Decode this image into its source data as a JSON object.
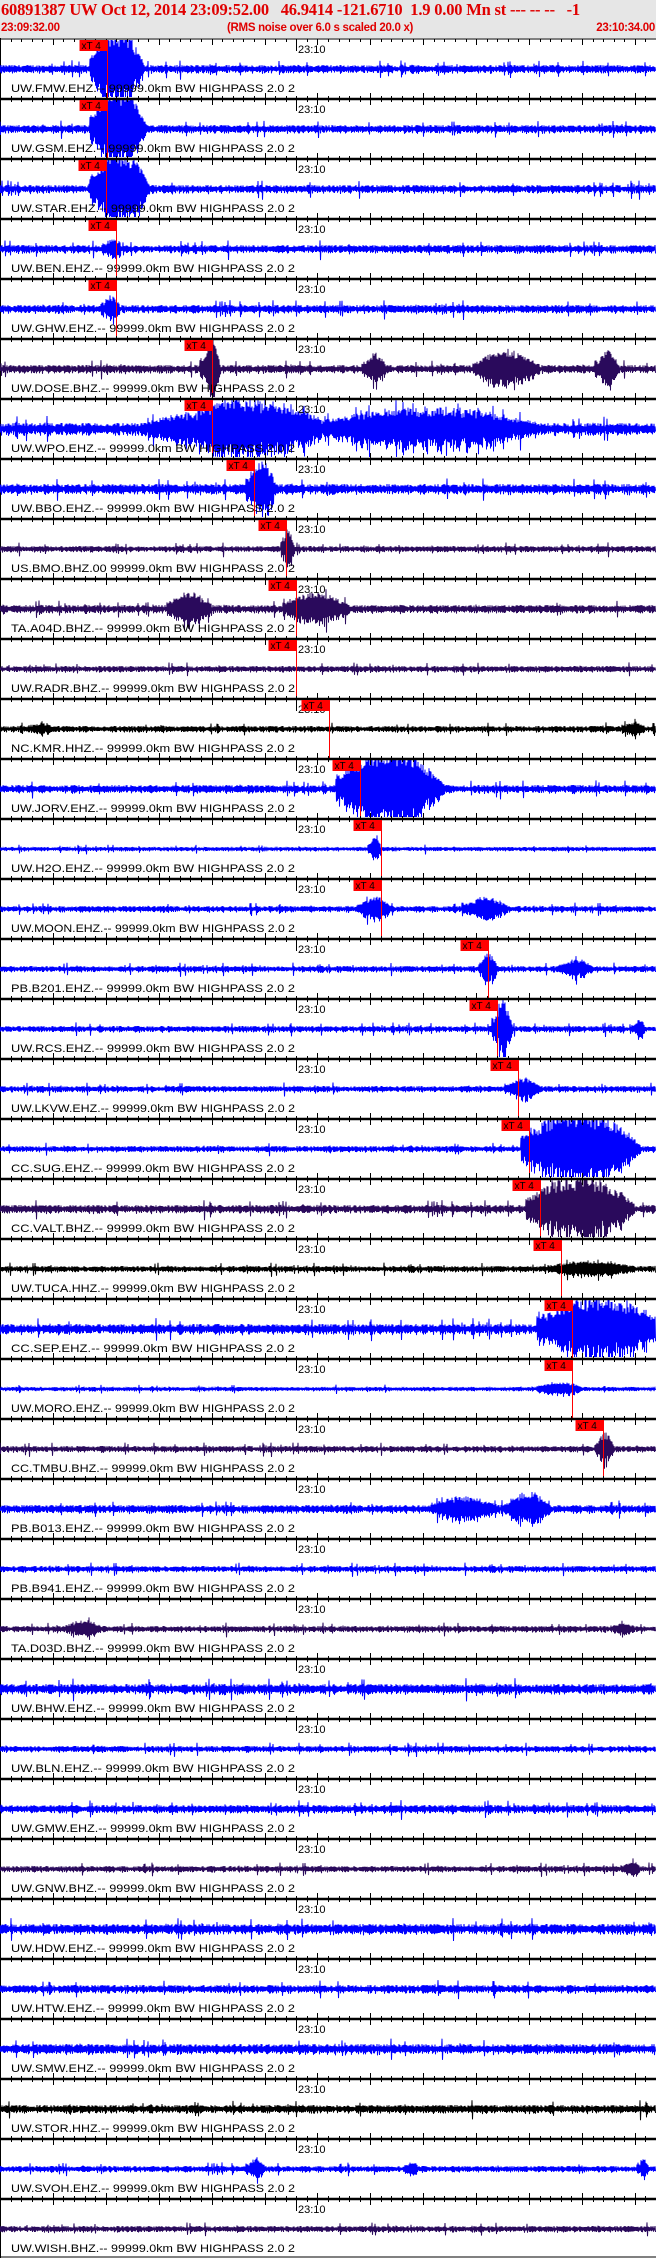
{
  "header": {
    "title": "60891387 UW Oct 12, 2014 23:09:52.00   46.9414 -121.6710  1.9 0.00 Mn st --- -- --   -1",
    "start_time": "23:09:32.00",
    "rms_note": "(RMS noise over 6.0 s scaled 20.0 x)",
    "end_time": "23:10:34.00"
  },
  "time_axis": {
    "span_seconds": 62,
    "minute_label": "23:10",
    "minute_offset_seconds": 28
  },
  "pick_label": "xT 4",
  "colors": {
    "EHZ": "#0000ff",
    "BHZ": "#2a0a5c",
    "HHZ": "#000000",
    "pick": "#ff0000",
    "header_bg": "#e6e6e6",
    "header_text": "#e00000"
  },
  "panels": [
    {
      "label": "UW.FMW.EHZ.-- 99999.0km BW  HIGHPASS  2.0  2",
      "chan": "EHZ",
      "pick_s": 10.1,
      "noise": 4,
      "bursts": [
        [
          8.8,
          4.8,
          40
        ]
      ]
    },
    {
      "label": "UW.GSM.EHZ.-- 99999.0km BW  HIGHPASS  2.0  2",
      "chan": "EHZ",
      "pick_s": 10.1,
      "noise": 4,
      "bursts": [
        [
          8.8,
          5.0,
          40
        ]
      ]
    },
    {
      "label": "UW.STAR.EHZ.-- 99999.0km BW  HIGHPASS  2.0  2",
      "chan": "EHZ",
      "pick_s": 10.0,
      "noise": 4,
      "bursts": [
        [
          8.8,
          5.3,
          40
        ]
      ]
    },
    {
      "label": "UW.BEN.EHZ.-- 99999.0km BW  HIGHPASS  2.0  2",
      "chan": "EHZ",
      "pick_s": 11.0,
      "noise": 4,
      "bursts": [
        [
          10,
          1.5,
          8
        ]
      ]
    },
    {
      "label": "UW.GHW.EHZ.-- 99999.0km BW  HIGHPASS  2.0  2",
      "chan": "EHZ",
      "pick_s": 11.0,
      "noise": 4,
      "bursts": [
        [
          9.8,
          1.5,
          12
        ]
      ]
    },
    {
      "label": "UW.DOSE.BHZ.-- 99999.0km BW  HIGHPASS  2.0  2",
      "chan": "BHZ",
      "pick_s": 20.0,
      "noise": 4,
      "bursts": [
        [
          19.2,
          1.6,
          30
        ],
        [
          34.5,
          2,
          14
        ],
        [
          45,
          6,
          16
        ],
        [
          56.5,
          2,
          16
        ]
      ]
    },
    {
      "label": "UW.WPO.EHZ.-- 99999.0km BW  HIGHPASS  2.0  2",
      "chan": "EHZ",
      "pick_s": 20.0,
      "noise": 6,
      "bursts": [
        [
          14,
          10,
          12
        ],
        [
          19,
          12,
          26
        ],
        [
          31,
          20,
          18
        ]
      ]
    },
    {
      "label": "UW.BBO.EHZ.-- 99999.0km BW  HIGHPASS  2.0  2",
      "chan": "EHZ",
      "pick_s": 24.0,
      "noise": 5,
      "bursts": [
        [
          23.5,
          2.5,
          28
        ]
      ]
    },
    {
      "label": "US.BMO.BHZ.00 99999.0km BW  HIGHPASS  2.0  2",
      "chan": "BHZ",
      "pick_s": 27.0,
      "noise": 3,
      "bursts": [
        [
          26.8,
          1,
          22
        ]
      ]
    },
    {
      "label": "TA.A04D.BHZ.-- 99999.0km BW  HIGHPASS  2.0  2",
      "chan": "BHZ",
      "pick_s": 28.0,
      "noise": 4,
      "bursts": [
        [
          16,
          4,
          14
        ],
        [
          27,
          6,
          14
        ]
      ]
    },
    {
      "label": "UW.RADR.BHZ.-- 99999.0km BW  HIGHPASS  2.0  2",
      "chan": "BHZ",
      "pick_s": 28.0,
      "noise": 3,
      "bursts": []
    },
    {
      "label": "NC.KMR.HHZ.-- 99999.0km BW  HIGHPASS  2.0  2",
      "chan": "HHZ",
      "pick_s": 31.1,
      "noise": 3,
      "bursts": [
        [
          3,
          2,
          4
        ],
        [
          59,
          2,
          5
        ]
      ]
    },
    {
      "label": "UW.JORV.EHZ.-- 99999.0km BW  HIGHPASS  2.0  2",
      "chan": "EHZ",
      "pick_s": 34.0,
      "noise": 4,
      "bursts": [
        [
          32,
          10,
          40
        ]
      ]
    },
    {
      "label": "UW.H2O.EHZ.-- 99999.0km BW  HIGHPASS  2.0  2",
      "chan": "EHZ",
      "pick_s": 36.0,
      "noise": 2,
      "bursts": [
        [
          35,
          1,
          14
        ]
      ]
    },
    {
      "label": "UW.MOON.EHZ.-- 99999.0km BW  HIGHPASS  2.0  2",
      "chan": "EHZ",
      "pick_s": 36.0,
      "noise": 3,
      "bursts": [
        [
          34,
          3,
          10
        ],
        [
          44,
          4,
          10
        ]
      ]
    },
    {
      "label": "PB.B201.EHZ.-- 99999.0km BW  HIGHPASS  2.0  2",
      "chan": "EHZ",
      "pick_s": 46.1,
      "noise": 3,
      "bursts": [
        [
          45.5,
          1.5,
          16
        ],
        [
          53,
          3,
          8
        ]
      ]
    },
    {
      "label": "UW.RCS.EHZ.-- 99999.0km BW  HIGHPASS  2.0  2",
      "chan": "EHZ",
      "pick_s": 47.0,
      "noise": 3,
      "bursts": [
        [
          46.8,
          1.6,
          30
        ],
        [
          60,
          1,
          8
        ]
      ]
    },
    {
      "label": "UW.LKVW.EHZ.-- 99999.0km BW  HIGHPASS  2.0  2",
      "chan": "EHZ",
      "pick_s": 49.0,
      "noise": 3,
      "bursts": [
        [
          48,
          3,
          9
        ]
      ]
    },
    {
      "label": "CC.SUG.EHZ.-- 99999.0km BW  HIGHPASS  2.0  2",
      "chan": "EHZ",
      "pick_s": 50.0,
      "noise": 3,
      "bursts": [
        [
          49.5,
          11,
          40
        ]
      ]
    },
    {
      "label": "CC.VALT.BHZ.-- 99999.0km BW  HIGHPASS  2.0  2",
      "chan": "BHZ",
      "pick_s": 51.0,
      "noise": 4,
      "bursts": [
        [
          50,
          10,
          32
        ]
      ]
    },
    {
      "label": "UW.TUCA.HHZ.-- 99999.0km BW  HIGHPASS  2.0  2",
      "chan": "HHZ",
      "pick_s": 53.0,
      "noise": 3,
      "bursts": [
        [
          52,
          8,
          6
        ]
      ]
    },
    {
      "label": "CC.SEP.EHZ.-- 99999.0km BW  HIGHPASS  2.0  2",
      "chan": "EHZ",
      "pick_s": 54.1,
      "noise": 5,
      "bursts": [
        [
          51,
          12,
          30
        ]
      ]
    },
    {
      "label": "UW.MORO.EHZ.-- 99999.0km BW  HIGHPASS  2.0  2",
      "chan": "EHZ",
      "pick_s": 54.1,
      "noise": 2,
      "bursts": [
        [
          51,
          4,
          6
        ]
      ]
    },
    {
      "label": "CC.TMBU.BHZ.-- 99999.0km BW  HIGHPASS  2.0  2",
      "chan": "BHZ",
      "pick_s": 57.0,
      "noise": 3,
      "bursts": [
        [
          56.5,
          1.5,
          15
        ]
      ]
    },
    {
      "label": "PB.B013.EHZ.-- 99999.0km BW  HIGHPASS  2.0  2",
      "chan": "EHZ",
      "pick_s": null,
      "noise": 4,
      "bursts": [
        [
          41,
          6,
          10
        ],
        [
          48,
          4,
          14
        ]
      ]
    },
    {
      "label": "PB.B941.EHZ.-- 99999.0km BW  HIGHPASS  2.0  2",
      "chan": "EHZ",
      "pick_s": null,
      "noise": 3,
      "bursts": []
    },
    {
      "label": "TA.D03D.BHZ.-- 99999.0km BW  HIGHPASS  2.0  2",
      "chan": "BHZ",
      "pick_s": null,
      "noise": 3,
      "bursts": [
        [
          6.5,
          3,
          7
        ],
        [
          58,
          2,
          4
        ]
      ]
    },
    {
      "label": "UW.BHW.EHZ.-- 99999.0km BW  HIGHPASS  2.0  2",
      "chan": "EHZ",
      "pick_s": null,
      "noise": 5,
      "bursts": []
    },
    {
      "label": "UW.BLN.EHZ.-- 99999.0km BW  HIGHPASS  2.0  2",
      "chan": "EHZ",
      "pick_s": null,
      "noise": 3,
      "bursts": []
    },
    {
      "label": "UW.GMW.EHZ.-- 99999.0km BW  HIGHPASS  2.0  2",
      "chan": "EHZ",
      "pick_s": null,
      "noise": 4,
      "bursts": []
    },
    {
      "label": "UW.GNW.BHZ.-- 99999.0km BW  HIGHPASS  2.0  2",
      "chan": "BHZ",
      "pick_s": null,
      "noise": 3,
      "bursts": [
        [
          59,
          1.5,
          6
        ]
      ]
    },
    {
      "label": "UW.HDW.EHZ.-- 99999.0km BW  HIGHPASS  2.0  2",
      "chan": "EHZ",
      "pick_s": null,
      "noise": 5,
      "bursts": []
    },
    {
      "label": "UW.HTW.EHZ.-- 99999.0km BW  HIGHPASS  2.0  2",
      "chan": "EHZ",
      "pick_s": null,
      "noise": 4,
      "bursts": []
    },
    {
      "label": "UW.SMW.EHZ.-- 99999.0km BW  HIGHPASS  2.0  2",
      "chan": "EHZ",
      "pick_s": null,
      "noise": 5,
      "bursts": []
    },
    {
      "label": "UW.STOR.HHZ.-- 99999.0km BW  HIGHPASS  2.0  2",
      "chan": "HHZ",
      "pick_s": null,
      "noise": 4,
      "bursts": []
    },
    {
      "label": "UW.SVOH.EHZ.-- 99999.0km BW  HIGHPASS  2.0  2",
      "chan": "EHZ",
      "pick_s": null,
      "noise": 3,
      "bursts": [
        [
          23.5,
          1.5,
          10
        ],
        [
          38.5,
          1,
          6
        ],
        [
          60.5,
          0.8,
          8
        ]
      ]
    },
    {
      "label": "UW.WISH.BHZ.-- 99999.0km BW  HIGHPASS  2.0  2",
      "chan": "BHZ",
      "pick_s": null,
      "noise": 3,
      "bursts": []
    }
  ]
}
